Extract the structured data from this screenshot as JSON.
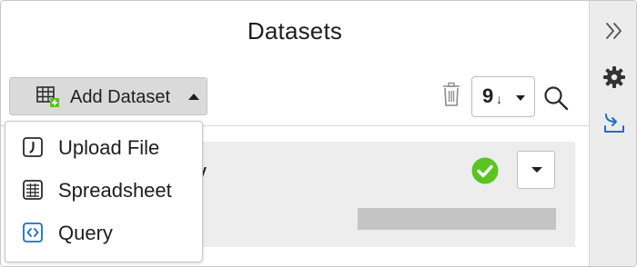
{
  "header": {
    "title": "Datasets"
  },
  "toolbar": {
    "add_dataset_label": "Add Dataset",
    "sort_value": "9",
    "sort_direction_glyph": "↓"
  },
  "add_menu": {
    "items": [
      {
        "label": "Upload File",
        "icon": "upload-file-icon"
      },
      {
        "label": "Spreadsheet",
        "icon": "spreadsheet-icon"
      },
      {
        "label": "Query",
        "icon": "query-icon"
      }
    ]
  },
  "dataset_row": {
    "name_visible": "v",
    "status": "success",
    "progress": 1.0
  },
  "sidebar": {
    "items": [
      {
        "icon": "collapse-chevrons-icon"
      },
      {
        "icon": "gear-icon"
      },
      {
        "icon": "import-icon"
      }
    ]
  },
  "colors": {
    "accent_green": "#5ac421",
    "accent_blue": "#1a6fc7",
    "button_gray": "#dadada",
    "sidebar_bg": "#ececec"
  }
}
